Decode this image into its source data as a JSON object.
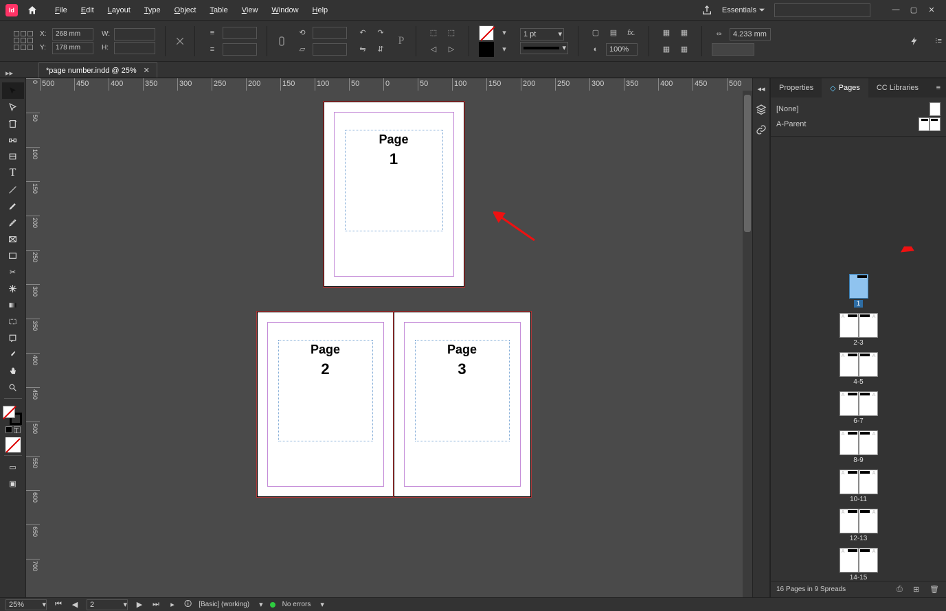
{
  "app": {
    "logo_text": "Id",
    "workspace": "Essentials"
  },
  "menu": [
    "File",
    "Edit",
    "Layout",
    "Type",
    "Object",
    "Table",
    "View",
    "Window",
    "Help"
  ],
  "window_controls": [
    "minimize",
    "maximize",
    "close"
  ],
  "control_bar": {
    "x_label": "X:",
    "x_value": "268 mm",
    "y_label": "Y:",
    "y_value": "178 mm",
    "w_label": "W:",
    "w_value": "",
    "h_label": "H:",
    "h_value": "",
    "stroke_weight": "1 pt",
    "opacity": "100%",
    "corner_value": "4.233 mm"
  },
  "document_tab": {
    "title": "*page number.indd @ 25%"
  },
  "ruler_h_labels": [
    "500",
    "450",
    "400",
    "350",
    "300",
    "250",
    "200",
    "150",
    "100",
    "50",
    "0",
    "50",
    "100",
    "150",
    "200",
    "250",
    "300",
    "350",
    "400",
    "450",
    "500"
  ],
  "ruler_v_labels": [
    "0",
    "50",
    "100",
    "150",
    "200",
    "250",
    "300",
    "350",
    "400",
    "450",
    "500",
    "550",
    "600",
    "650",
    "700"
  ],
  "pages_on_canvas": [
    {
      "label": "Page",
      "number": "1"
    },
    {
      "label": "Page",
      "number": "2"
    },
    {
      "label": "Page",
      "number": "3"
    }
  ],
  "panels": {
    "tabs": [
      "Properties",
      "Pages",
      "CC Libraries"
    ],
    "active_tab": "Pages",
    "parent_pages": [
      {
        "name": "[None]"
      },
      {
        "name": "A-Parent"
      }
    ],
    "page_thumbs": [
      {
        "label": "1",
        "selected": true,
        "pages": 1
      },
      {
        "label": "2-3",
        "selected": false,
        "pages": 2
      },
      {
        "label": "4-5",
        "selected": false,
        "pages": 2
      },
      {
        "label": "6-7",
        "selected": false,
        "pages": 2
      },
      {
        "label": "8-9",
        "selected": false,
        "pages": 2
      },
      {
        "label": "10-11",
        "selected": false,
        "pages": 2
      },
      {
        "label": "12-13",
        "selected": false,
        "pages": 2
      },
      {
        "label": "14-15",
        "selected": false,
        "pages": 2
      }
    ],
    "footer_text": "16 Pages in 9 Spreads"
  },
  "status_bar": {
    "zoom": "25%",
    "page_field": "2",
    "style_info": "[Basic] (working)",
    "errors": "No errors"
  },
  "tools": [
    "selection",
    "direct-selection",
    "page",
    "gap",
    "content-collector",
    "type",
    "line",
    "pen",
    "pencil",
    "rectangle-frame",
    "rectangle",
    "scissors",
    "free-transform",
    "gradient-swatch",
    "gradient-feather",
    "note",
    "eyedropper",
    "hand",
    "zoom"
  ]
}
